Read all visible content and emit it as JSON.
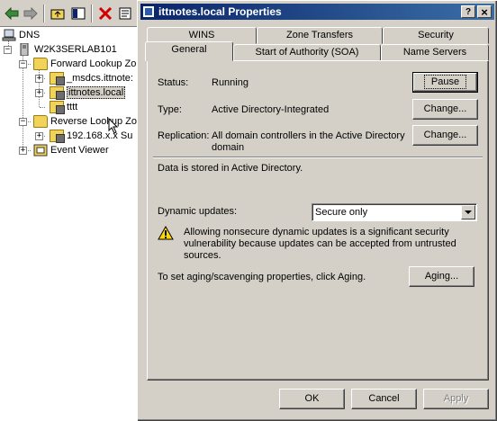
{
  "toolbar": {
    "icons": [
      "back-arrow-icon",
      "forward-arrow-icon",
      "up-folder-icon",
      "show-hide-tree-icon",
      "delete-icon",
      "properties-icon"
    ]
  },
  "tree": {
    "root": "DNS",
    "server": "W2K3SERLAB101",
    "forward_zones": "Forward Lookup Zo",
    "msdcs": "_msdcs.ittnote:",
    "ittnotes": "ittnotes.local",
    "tttt": "tttt",
    "reverse_zones": "Reverse Lookup Zo",
    "reverse_zone": "192.168.x.x Su",
    "event_viewer": "Event Viewer"
  },
  "dialog": {
    "title": "ittnotes.local Properties",
    "help_button": "?",
    "close_button": "×",
    "tabs_back": [
      "WINS",
      "Zone Transfers",
      "Security"
    ],
    "tabs_front": [
      "General",
      "Start of Authority (SOA)",
      "Name Servers"
    ],
    "active_tab": "General",
    "status_label": "Status:",
    "status_value": "Running",
    "pause_button": "Pause",
    "type_label": "Type:",
    "type_value": "Active Directory-Integrated",
    "type_change_button": "Change...",
    "replication_label": "Replication:",
    "replication_value_1": "All domain controllers in the Active Directory",
    "replication_value_2": "domain",
    "replication_change_button": "Change...",
    "data_stored": "Data is stored in Active Directory.",
    "dynamic_updates_label": "Dynamic updates:",
    "dynamic_updates_value": "Secure only",
    "warning_1": "Allowing nonsecure dynamic updates is a significant security",
    "warning_2": "vulnerability because updates can be accepted from untrusted",
    "warning_3": "sources.",
    "aging_text": "To set aging/scavenging properties, click Aging.",
    "aging_button": "Aging...",
    "ok_button": "OK",
    "cancel_button": "Cancel",
    "apply_button": "Apply"
  },
  "colors": {
    "title_bar_start": "#0a246a",
    "title_bar_end": "#3a6ea5",
    "face": "#d4d0c8",
    "warning_yellow": "#ffd800"
  }
}
